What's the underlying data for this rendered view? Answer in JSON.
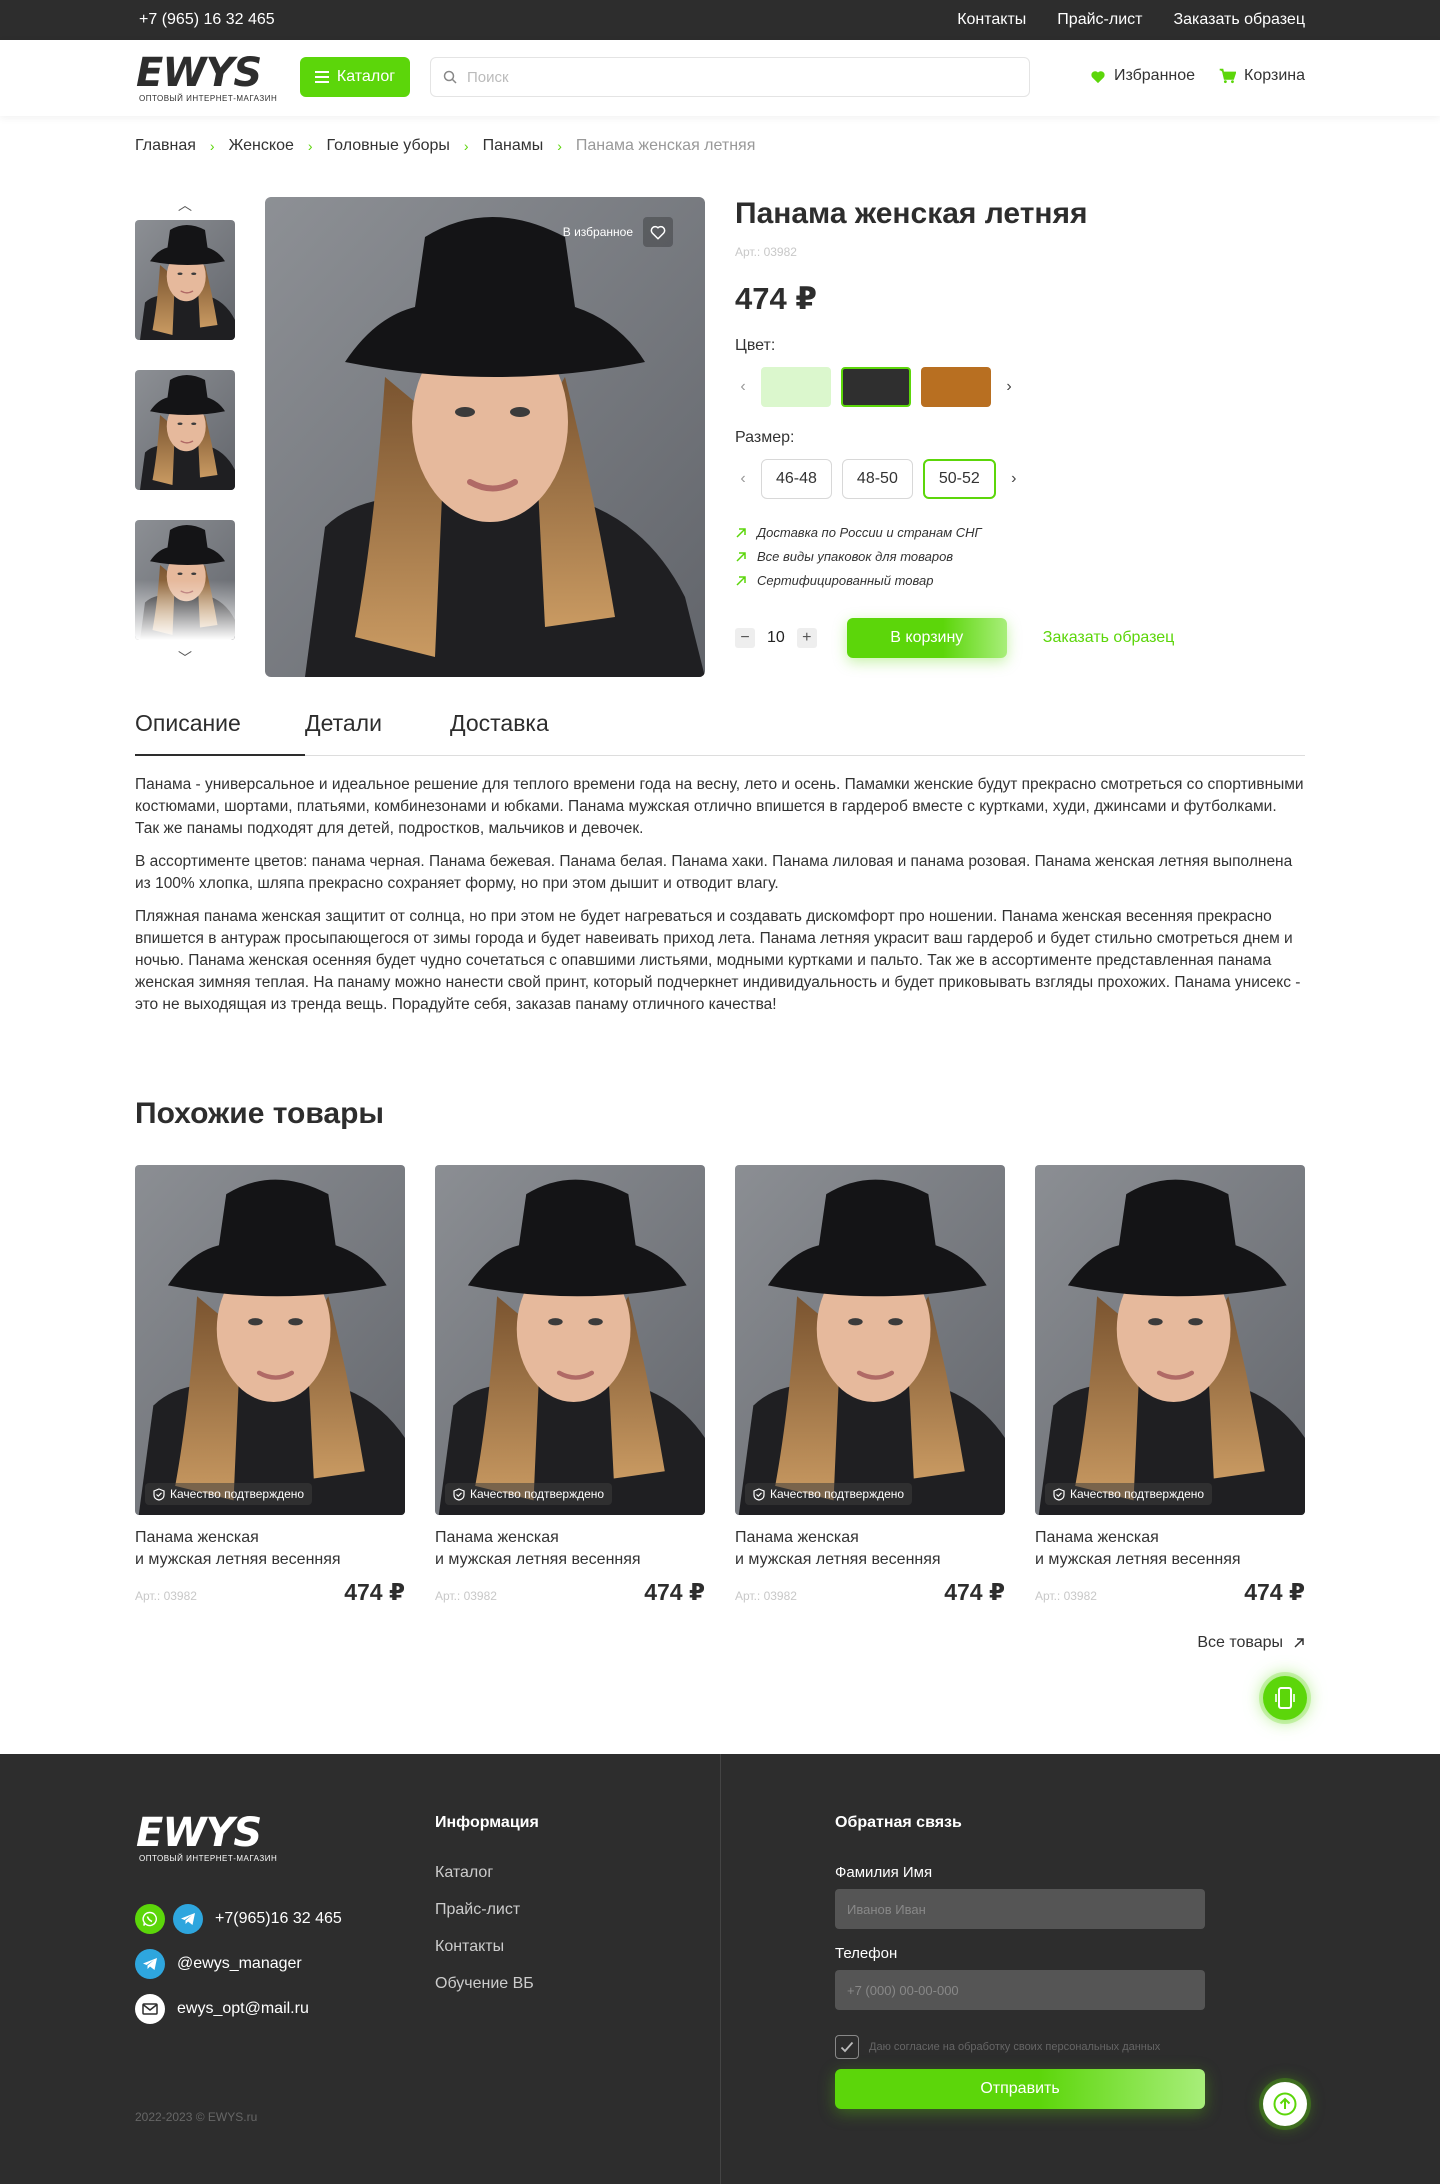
{
  "topbar": {
    "phone": "+7 (965) 16 32 465",
    "links": [
      "Контакты",
      "Прайс-лист",
      "Заказать образец"
    ]
  },
  "header": {
    "logo_text": "EWYS",
    "logo_sub": "ОПТОВЫЙ ИНТЕРНЕТ-МАГАЗИН",
    "catalog_label": "Каталог",
    "search_placeholder": "Поиск",
    "favorites_label": "Избранное",
    "cart_label": "Корзина"
  },
  "breadcrumbs": [
    "Главная",
    "Женское",
    "Головные уборы",
    "Панамы",
    "Панама женская летняя"
  ],
  "gallery": {
    "favorite_label": "В избранное"
  },
  "product": {
    "title": "Панама женская летняя",
    "article": "Арт.: 03982",
    "price": "474 ₽",
    "color_label": "Цвет:",
    "colors": [
      "#dbf7cd",
      "#2f2f2f",
      "#b86f21"
    ],
    "selected_color_index": 1,
    "size_label": "Размер:",
    "sizes": [
      "46-48",
      "48-50",
      "50-52"
    ],
    "selected_size_index": 2,
    "features": [
      "Доставка по России и странам СНГ",
      "Все виды упаковок для товаров",
      "Сертифицированный товар"
    ],
    "quantity": "10",
    "cart_button": "В корзину",
    "sample_link": "Заказать образец"
  },
  "tabs": [
    "Описание",
    "Детали",
    "Доставка"
  ],
  "description": [
    "Панама - универсальное и идеальное решение для теплого времени года на весну, лето и осень. Памамки женские будут прекрасно смотреться со спортивными костюмами, шортами, платьями, комбинезонами и юбками. Панама мужская отлично впишется в гардероб вместе с куртками, худи, джинсами и футболками. Так же панамы подходят для детей, подростков, мальчиков и девочек.",
    "В ассортименте цветов: панама черная. Панама бежевая. Панама белая. Панама хаки. Панама лиловая и панама розовая. Панама женская летняя выполнена из 100% хлопка, шляпа прекрасно сохраняет форму, но при этом дышит и отводит влагу.",
    "Пляжная панама женская защитит от солнца, но при этом не будет нагреваться и создавать дискомфорт про ношении. Панама женская весенняя прекрасно впишется в антураж просыпающегося от зимы города и будет навеивать приход лета. Панама летняя украсит ваш гардероб и будет стильно смотреться днем и ночью. Панама женская осенняя будет чудно сочетаться с опавшими листьями, модными куртками и пальто. Так же в ассортименте представленная панама женская зимняя теплая. На панаму можно нанести свой принт, который подчеркнет индивидуальность и будет приковывать взгляды прохожих. Панама унисекс - это не выходящая из тренда вещь. Порадуйте себя, заказав панаму отличного качества!"
  ],
  "similar": {
    "title": "Похожие товары",
    "badge": "Качество подтверждено",
    "items": [
      {
        "name_line1": "Панама женская",
        "name_line2": "и мужская летняя весенняя",
        "article": "Арт.: 03982",
        "price": "474 ₽"
      },
      {
        "name_line1": "Панама женская",
        "name_line2": "и мужская летняя весенняя",
        "article": "Арт.: 03982",
        "price": "474 ₽"
      },
      {
        "name_line1": "Панама женская",
        "name_line2": "и мужская летняя весенняя",
        "article": "Арт.: 03982",
        "price": "474 ₽"
      },
      {
        "name_line1": "Панама женская",
        "name_line2": "и мужская летняя весенняя",
        "article": "Арт.: 03982",
        "price": "474 ₽"
      }
    ],
    "all_link": "Все товары"
  },
  "footer": {
    "logo_text": "EWYS",
    "logo_sub": "ОПТОВЫЙ ИНТЕРНЕТ-МАГАЗИН",
    "phone": "+7(965)16 32 465",
    "telegram": "@ewys_manager",
    "email": "ewys_opt@mail.ru",
    "copyright": "2022-2023 © EWYS.ru",
    "info_title": "Информация",
    "info_links": [
      "Каталог",
      "Прайс-лист",
      "Контакты",
      "Обучение ВБ"
    ],
    "form_title": "Обратная связь",
    "name_label": "Фамилия Имя",
    "name_placeholder": "Иванов Иван",
    "phone_label": "Телефон",
    "phone_placeholder": "+7 (000) 00-00-000",
    "consent": "Даю согласие на обработку своих персональных данных",
    "submit": "Отправить"
  },
  "colors": {
    "accent": "#5cd60a",
    "dark": "#2d2d2d",
    "telegram": "#2ea6de"
  }
}
